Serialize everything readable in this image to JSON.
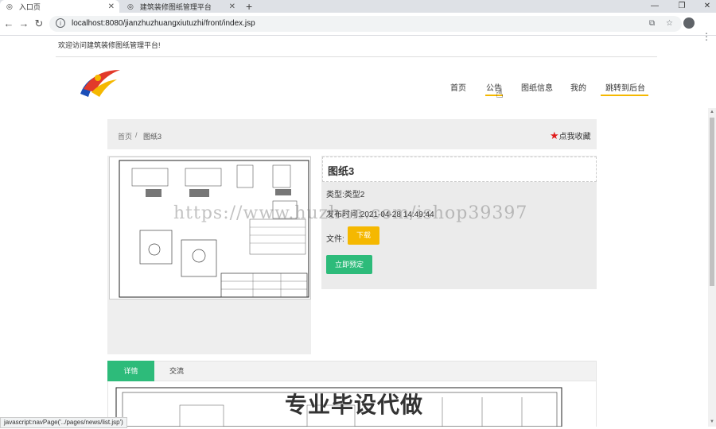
{
  "browser": {
    "tabs": [
      {
        "title": "入口页",
        "active": true
      },
      {
        "title": "建筑装修图纸管理平台",
        "active": false
      }
    ],
    "new_tab": "+",
    "url": "localhost:8080/jianzhuzhuangxiutuzhi/front/index.jsp",
    "status_text": "javascript:navPage('../pages/news/list.jsp')"
  },
  "page": {
    "welcome": "欢迎访问建筑装修图纸管理平台!",
    "nav": [
      "首页",
      "公告",
      "图纸信息",
      "我的",
      "跳转到后台"
    ],
    "breadcrumb": {
      "home": "首页",
      "sep": "/",
      "current": "图纸3"
    },
    "favorite": {
      "icon": "★",
      "label": "点我收藏"
    },
    "detail": {
      "title": "图纸3",
      "type_label": "类型:",
      "type_value": "类型2",
      "time_label": "发布时间:",
      "time_value": "2021-04-28 14:49:44",
      "file_label": "文件:",
      "download_label": "下载",
      "book_label": "立即预定"
    },
    "tabs": [
      "详情",
      "交流"
    ]
  },
  "overlay": {
    "watermark": "https://www.huzhan.com/ishop39397",
    "banner": "专业毕设代做"
  },
  "colors": {
    "accent": "#f5b800",
    "green": "#2dbb7a",
    "star": "#e01b1b"
  }
}
